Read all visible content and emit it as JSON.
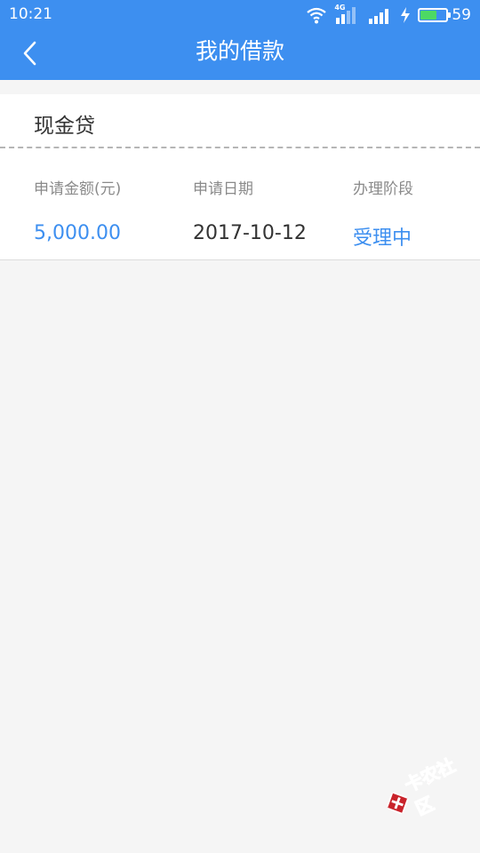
{
  "status_bar": {
    "time": "10:21",
    "network_label": "4G",
    "battery_level": "59",
    "battery_fraction": 0.59,
    "icons": [
      "wifi-icon",
      "signal-4g-icon",
      "signal-icon",
      "charging-icon",
      "battery-icon"
    ]
  },
  "header": {
    "title": "我的借款",
    "back_icon": "chevron-left-icon",
    "background_color": "#3d8ff0"
  },
  "loan_card": {
    "title": "现金贷",
    "columns": [
      {
        "label": "申请金额(元)",
        "value": "5,000.00"
      },
      {
        "label": "申请日期",
        "value": "2017-10-12"
      },
      {
        "label": "办理阶段",
        "value": "受理中"
      }
    ],
    "accent_color": "#3d8ff0"
  },
  "watermark": {
    "text": "卡农社区",
    "color": "#c9232b"
  }
}
